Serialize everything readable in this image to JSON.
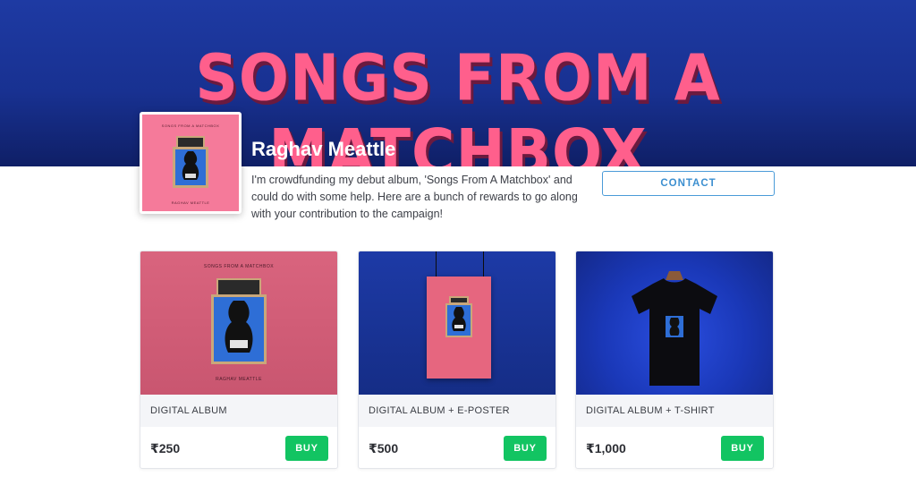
{
  "header": {
    "title": "SONGS FROM A MATCHBOX"
  },
  "profile": {
    "name": "Raghav Meattle",
    "bio": "I'm crowdfunding my debut album, 'Songs From A Matchbox' and could do with some help. Here are a bunch of rewards to go along with your contribution to the campaign!",
    "contact_label": "CONTACT",
    "cover_small_title": "SONGS FROM A MATCHBOX",
    "cover_small_artist": "RAGHAV MEATTLE"
  },
  "rewards": [
    {
      "label": "DIGITAL ALBUM",
      "price": "₹250",
      "buy_label": "BUY",
      "cover_title": "SONGS FROM A MATCHBOX",
      "cover_artist": "RAGHAV MEATTLE"
    },
    {
      "label": "DIGITAL ALBUM + E-POSTER",
      "price": "₹500",
      "buy_label": "BUY"
    },
    {
      "label": "DIGITAL ALBUM + T-SHIRT",
      "price": "₹1,000",
      "buy_label": "BUY"
    }
  ],
  "colors": {
    "hero_blue": "#1e3aa3",
    "title_pink": "#ff5f8c",
    "cover_pink": "#f57a9a",
    "buy_green": "#12c462",
    "contact_blue": "#3c8fd0"
  }
}
